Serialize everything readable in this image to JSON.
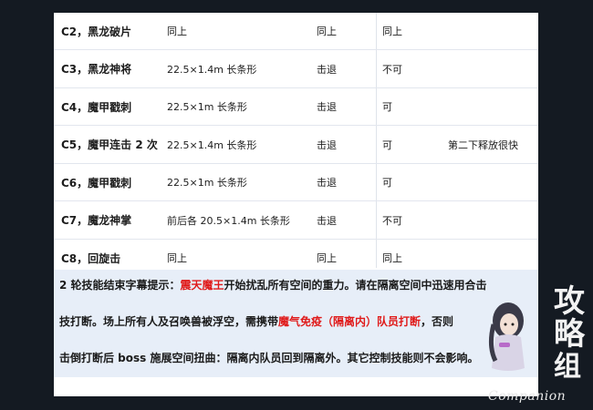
{
  "table": {
    "rows": [
      {
        "skill": "C2，黑龙破片",
        "range": "同上",
        "knockback": "同上",
        "interrupt": "同上",
        "note": ""
      },
      {
        "skill": "C3，黑龙神将",
        "range": "22.5×1.4m 长条形",
        "knockback": "击退",
        "interrupt": "不可",
        "note": ""
      },
      {
        "skill": "C4，魔甲戳刺",
        "range": "22.5×1m 长条形",
        "knockback": "击退",
        "interrupt": "可",
        "note": ""
      },
      {
        "skill": "C5，魔甲连击 2 次",
        "range": "22.5×1.4m 长条形",
        "knockback": "击退",
        "interrupt": "可",
        "note": "第二下释放很快"
      },
      {
        "skill": "C6，魔甲戳刺",
        "range": "22.5×1m 长条形",
        "knockback": "击退",
        "interrupt": "可",
        "note": ""
      },
      {
        "skill": "C7，魔龙神掌",
        "range": "前后各 20.5×1.4m 长条形",
        "knockback": "击退",
        "interrupt": "不可",
        "note": ""
      },
      {
        "skill": "C8，回旋击",
        "range": "同上",
        "knockback": "同上",
        "interrupt": "同上",
        "note": ""
      }
    ]
  },
  "paragraph": {
    "line1": [
      {
        "text": "2 轮技能结束字幕提示：",
        "red": false
      },
      {
        "text": "震天魔王",
        "red": true
      },
      {
        "text": "开始扰乱所有空间的重力。请在隔离空间中迅速用合击",
        "red": false
      }
    ],
    "line2": [
      {
        "text": "技打断。场上所有人及召唤兽被浮空，需携带",
        "red": false
      },
      {
        "text": "魔气免疫（隔离内）队员打断",
        "red": true
      },
      {
        "text": "，否则",
        "red": false
      }
    ],
    "line3": [
      {
        "text": "击倒打断后 boss 施展空间扭曲：隔离内队员回到隔离外。其它控制技能则不会影响。",
        "red": false
      }
    ]
  },
  "watermark": {
    "text": "Companion",
    "glyphs": "攻略组",
    "colors": {
      "glyph": "#f2f2f2",
      "hair": "#3a3a48",
      "skin": "#f3e1d6",
      "robe": "#d9d4e6"
    }
  },
  "colors": {
    "background": "#141a22",
    "card": "#ffffff",
    "highlight": "#e7eef8",
    "red": "#e01a1a"
  }
}
